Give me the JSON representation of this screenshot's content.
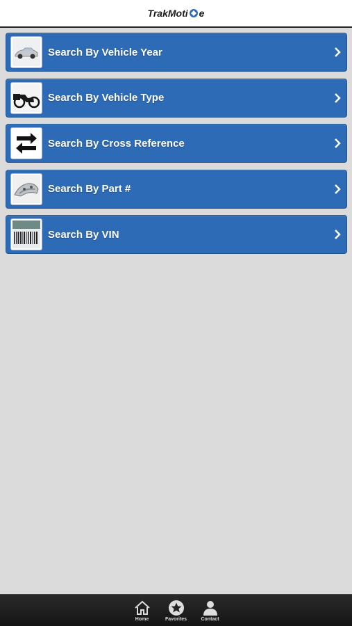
{
  "header": {
    "logo_text_a": "TrakMoti",
    "logo_text_b": "e"
  },
  "items": [
    {
      "label": "Search By Vehicle Year",
      "icon": "car-icon"
    },
    {
      "label": "Search By Vehicle Type",
      "icon": "motorcycle-icon"
    },
    {
      "label": "Search By Cross Reference",
      "icon": "swap-arrows-icon"
    },
    {
      "label": "Search By Part #",
      "icon": "brake-part-icon"
    },
    {
      "label": "Search By VIN",
      "icon": "barcode-icon"
    }
  ],
  "tabbar": {
    "home": "Home",
    "favorites": "Favorites",
    "contact": "Contact"
  },
  "colors": {
    "accent": "#2e6bb6",
    "background": "#dcdbdc",
    "tabbar": "#1e1e1e"
  }
}
